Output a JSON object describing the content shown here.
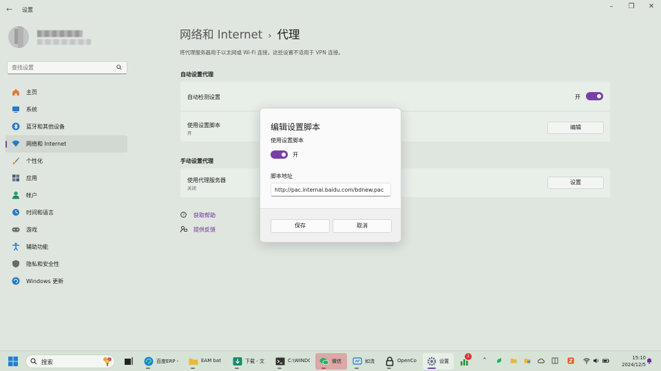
{
  "window": {
    "title": "设置",
    "controls": [
      "minimize-icon",
      "maximize-icon",
      "close-icon"
    ]
  },
  "sidebar": {
    "search_placeholder": "查找设置",
    "items": [
      {
        "label": "主页",
        "icon": "home-icon",
        "color": "#e07a3a"
      },
      {
        "label": "系统",
        "icon": "system-icon",
        "color": "#2b78c4"
      },
      {
        "label": "蓝牙和其他设备",
        "icon": "bluetooth-icon",
        "color": "#2b78c4"
      },
      {
        "label": "网络和 Internet",
        "icon": "wifi-icon",
        "color": "#2b78c4",
        "active": true
      },
      {
        "label": "个性化",
        "icon": "brush-icon",
        "color": "#d08a2a"
      },
      {
        "label": "应用",
        "icon": "apps-icon",
        "color": "#4a5a7a"
      },
      {
        "label": "帐户",
        "icon": "account-icon",
        "color": "#2aa07a"
      },
      {
        "label": "时间和语言",
        "icon": "globe-clock-icon",
        "color": "#2b78c4"
      },
      {
        "label": "游戏",
        "icon": "gamepad-icon",
        "color": "#6a6a6a"
      },
      {
        "label": "辅助功能",
        "icon": "accessibility-icon",
        "color": "#2b78c4"
      },
      {
        "label": "隐私和安全性",
        "icon": "shield-icon",
        "color": "#6a6a6a"
      },
      {
        "label": "Windows 更新",
        "icon": "update-icon",
        "color": "#2b78c4"
      }
    ]
  },
  "main": {
    "breadcrumb_parent": "网络和 Internet",
    "breadcrumb_sep": "›",
    "breadcrumb_current": "代理",
    "description": "将代理服务器用于以太网或 Wi-Fi 连接。这些设置不适用于 VPN 连接。",
    "auto_section": "自动设置代理",
    "auto_detect_label": "自动检测设置",
    "auto_detect_state": "开",
    "script_label": "使用设置脚本",
    "script_state": "开",
    "edit_button": "编辑",
    "manual_section": "手动设置代理",
    "proxy_server_label": "使用代理服务器",
    "proxy_server_state": "关闭",
    "setup_button": "设置",
    "help_link": "获取帮助",
    "feedback_link": "提供反馈"
  },
  "dialog": {
    "title": "编辑设置脚本",
    "toggle_label": "使用设置脚本",
    "toggle_state": "开",
    "address_label": "脚本地址",
    "address_value": "http://pac.internal.baidu.com/bdnew.pac",
    "save_button": "保存",
    "cancel_button": "取消"
  },
  "taskbar": {
    "search_placeholder": "搜索",
    "apps": [
      {
        "label": "百度ERP -",
        "icon": "edge-icon",
        "color": "#1f7fd6"
      },
      {
        "label": "EAM bat",
        "icon": "folder-icon",
        "color": "#e8b93a"
      },
      {
        "label": "下载 - 文",
        "icon": "download-icon",
        "color": "#1a8a6a"
      },
      {
        "label": "C:\\WINDC",
        "icon": "terminal-icon",
        "color": "#333333"
      },
      {
        "label": "微信",
        "icon": "wechat-icon",
        "color": "#2aae67",
        "highlight": true
      },
      {
        "label": "如流",
        "icon": "ruliu-icon",
        "color": "#2b6fd6"
      },
      {
        "label": "OpenCo",
        "icon": "lock-icon",
        "color": "#222222"
      },
      {
        "label": "设置",
        "icon": "gear-icon",
        "color": "#5a6a8a",
        "active": true
      }
    ],
    "badge_count": "1",
    "time": "15:10",
    "date": "2024/12/5",
    "accent": "#7a3fa7"
  }
}
